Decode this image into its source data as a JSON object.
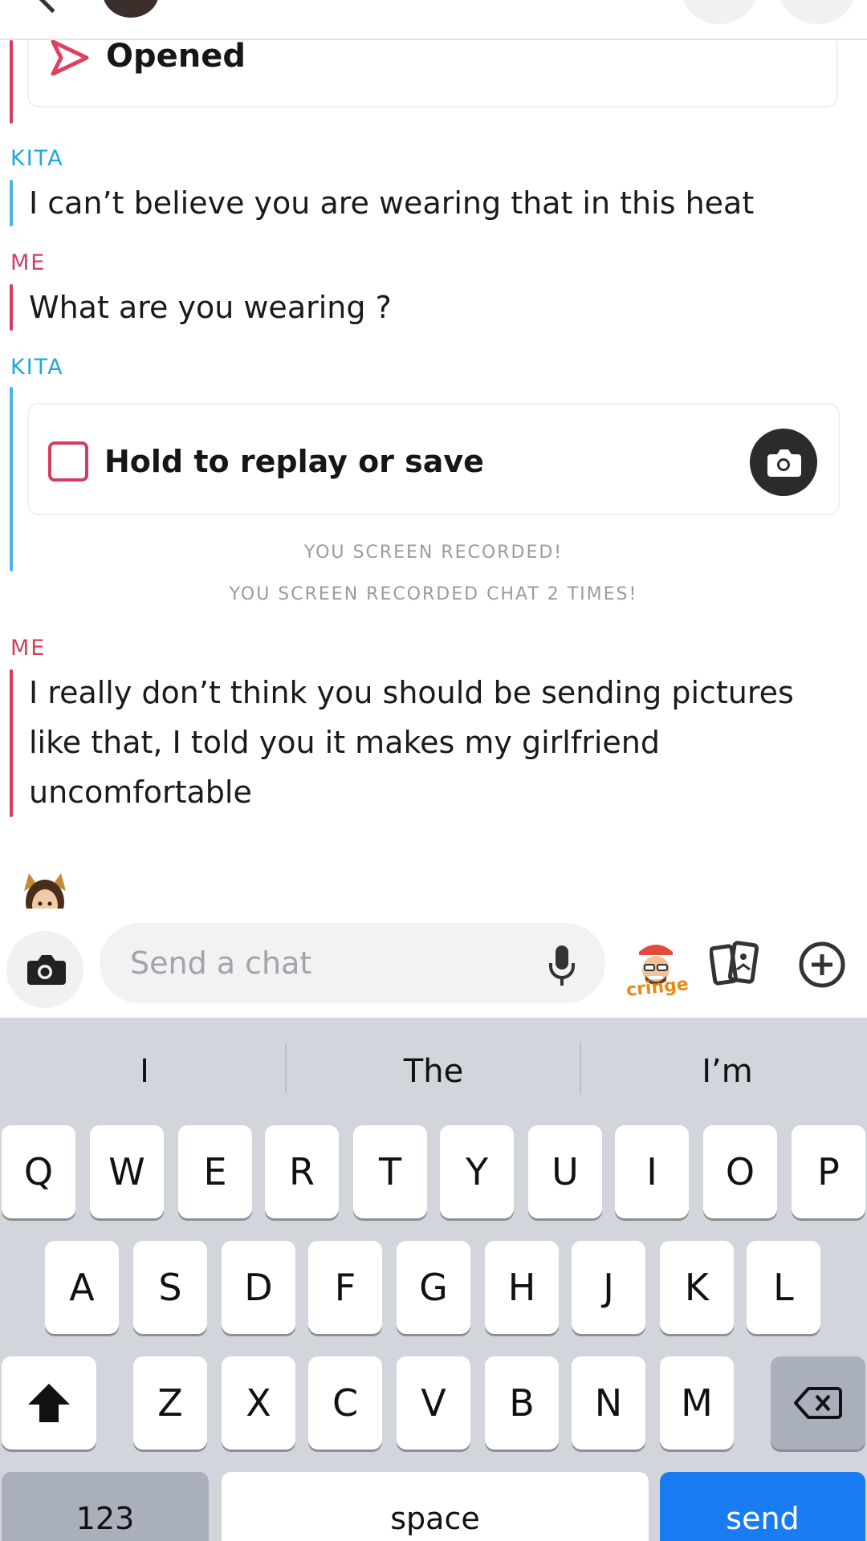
{
  "status": {
    "opened_label": "Opened"
  },
  "messages": [
    {
      "sender": "KITA",
      "text": "I can’t believe you are wearing that in this heat"
    },
    {
      "sender": "ME",
      "text": "What are you wearing ?"
    },
    {
      "sender": "KITA",
      "snap_label": "Hold to replay or save"
    },
    {
      "sender": "ME",
      "lines": [
        "I really don’t think you should be sending pictures",
        "like that, I told you it makes my girlfriend",
        "uncomfortable"
      ]
    }
  ],
  "notices": [
    "YOU SCREEN RECORDED!",
    "YOU SCREEN RECORDED CHAT 2 TIMES!"
  ],
  "composer": {
    "placeholder": "Send a chat",
    "bitmoji_caption": "cringe"
  },
  "keyboard": {
    "suggestions": [
      "I",
      "The",
      "I’m"
    ],
    "row1": [
      "Q",
      "W",
      "E",
      "R",
      "T",
      "Y",
      "U",
      "I",
      "O",
      "P"
    ],
    "row2": [
      "A",
      "S",
      "D",
      "F",
      "G",
      "H",
      "J",
      "K",
      "L"
    ],
    "row3": [
      "Z",
      "X",
      "C",
      "V",
      "B",
      "N",
      "M"
    ],
    "numbers_label": "123",
    "space_label": "space",
    "send_label": "send"
  },
  "colors": {
    "kita": "#1fa7e1",
    "me": "#d43d5e",
    "send_key": "#1a7cf2"
  }
}
